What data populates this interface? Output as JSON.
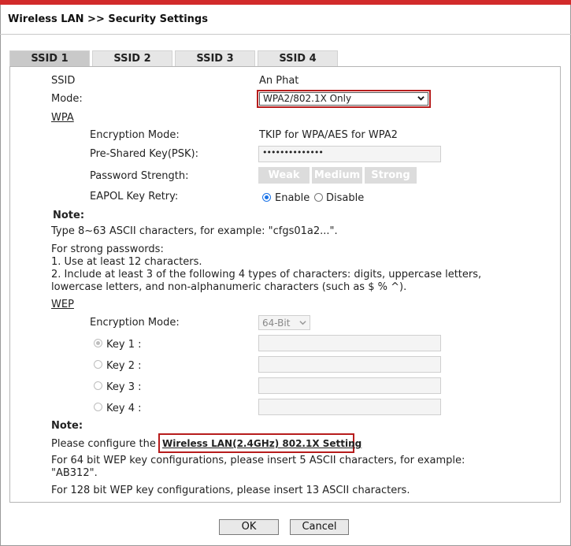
{
  "page": {
    "title": "Wireless LAN >> Security Settings"
  },
  "tabs": [
    "SSID 1",
    "SSID 2",
    "SSID 3",
    "SSID 4"
  ],
  "ssid": {
    "label": "SSID",
    "value": "An Phat"
  },
  "mode": {
    "label": "Mode:",
    "value": "WPA2/802.1X Only"
  },
  "wpa": {
    "heading": "WPA",
    "encryption_label": "Encryption Mode:",
    "encryption_value": "TKIP for WPA/AES for WPA2",
    "psk_label": "Pre-Shared Key(PSK):",
    "psk_value": "••••••••••••••",
    "strength_label": "Password Strength:",
    "strength_weak": "Weak",
    "strength_medium": "Medium",
    "strength_strong": "Strong",
    "eapol_label": "EAPOL Key Retry:",
    "eapol_enable": "Enable",
    "eapol_disable": "Disable"
  },
  "note1": {
    "heading": "Note:",
    "line1": "Type 8~63 ASCII characters, for example: \"cfgs01a2...\".",
    "line2": "For strong passwords:",
    "line3": "1. Use at least 12 characters.",
    "line4": "2. Include at least 3 of the following 4 types of characters: digits, uppercase letters,",
    "line5": "lowercase letters, and non-alphanumeric characters (such as $ % ^)."
  },
  "wep": {
    "heading": "WEP",
    "encryption_label": "Encryption Mode:",
    "encryption_value": "64-Bit",
    "key1": "Key 1 :",
    "key2": "Key 2 :",
    "key3": "Key 3 :",
    "key4": "Key 4 :"
  },
  "note2": {
    "heading": "Note:",
    "configure_prefix": "Please configure the",
    "configure_link": "Wireless LAN(2.4GHz) 802.1X Setting",
    "configure_suffix": ".",
    "line64a": "For 64 bit WEP key configurations, please insert 5 ASCII characters, for example:",
    "line64b": "\"AB312\".",
    "line128": "For 128 bit WEP key configurations, please insert 13 ASCII characters."
  },
  "buttons": {
    "ok": "OK",
    "cancel": "Cancel"
  },
  "colors": {
    "accent_red": "#b71c1c",
    "radio_blue": "#1a73e8"
  }
}
